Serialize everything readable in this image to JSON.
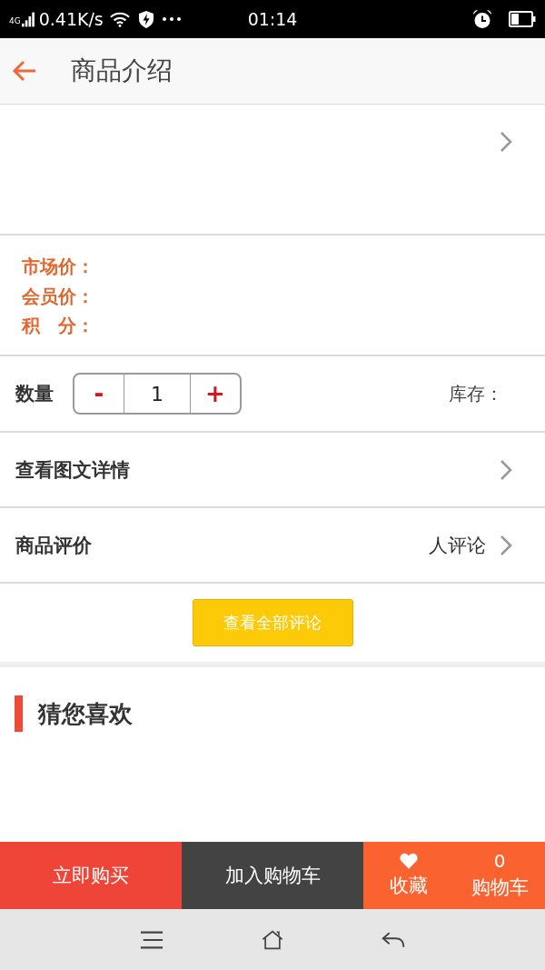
{
  "status_bar": {
    "network_type": "4G",
    "speed": "0.41K/s",
    "time": "01:14"
  },
  "header": {
    "title": "商品介绍"
  },
  "prices": [
    {
      "label": "市场价："
    },
    {
      "label": "会员价："
    },
    {
      "label": "积　分："
    }
  ],
  "quantity": {
    "label": "数量",
    "minus": "-",
    "value": "1",
    "plus": "+",
    "stock_label": "库存："
  },
  "links": [
    {
      "label": "查看图文详情"
    },
    {
      "label": "商品评价",
      "note": "人评论"
    }
  ],
  "all_reviews_button": "查看全部评论",
  "recommend": {
    "title": "猜您喜欢"
  },
  "action_bar": {
    "buy_now": "立即购买",
    "add_to_cart": "加入购物车",
    "favorite": "收藏",
    "cart_count": "0",
    "cart": "购物车"
  }
}
